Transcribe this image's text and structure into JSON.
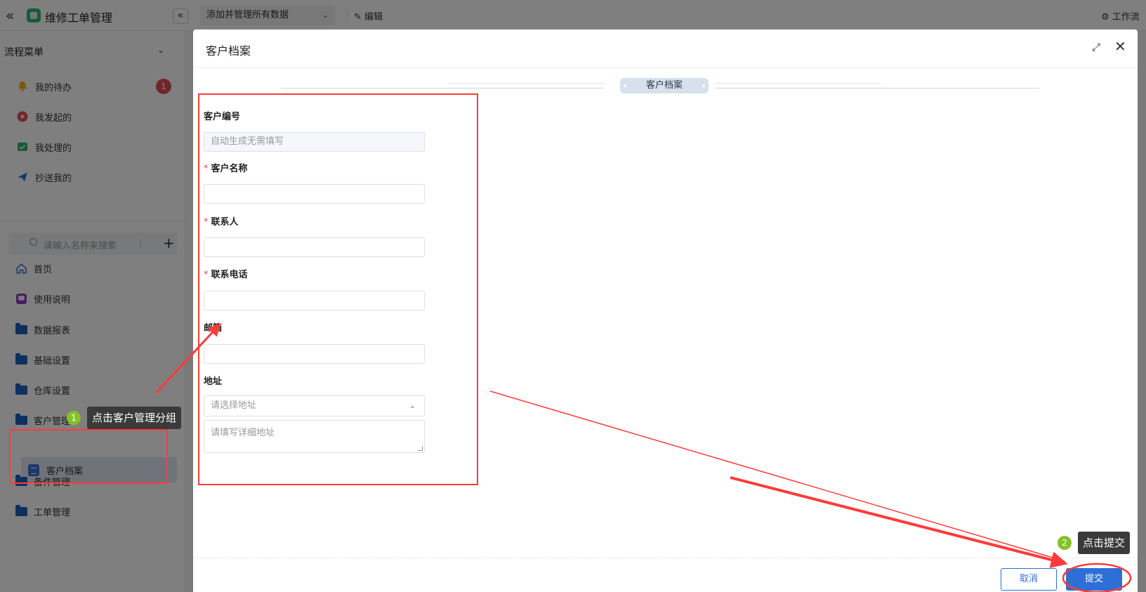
{
  "app": {
    "title": "维修工单管理",
    "view_select": "添加并管理所有数据",
    "edit_label": "编辑",
    "workflow_label": "工作流"
  },
  "sidebar": {
    "section_title": "流程菜单",
    "flow_items": [
      {
        "label": "我的待办",
        "icon": "bell-icon",
        "badge": "1"
      },
      {
        "label": "我发起的",
        "icon": "play-circle-icon"
      },
      {
        "label": "我处理的",
        "icon": "check-box-icon"
      },
      {
        "label": "抄送我的",
        "icon": "send-icon"
      }
    ],
    "search_placeholder": "请输入名称来搜索",
    "nav_items": [
      {
        "label": "首页",
        "icon": "home-icon"
      },
      {
        "label": "使用说明",
        "icon": "guide-icon"
      },
      {
        "label": "数据报表",
        "icon": "folder-icon"
      },
      {
        "label": "基础设置",
        "icon": "folder-icon"
      },
      {
        "label": "仓库设置",
        "icon": "folder-icon"
      },
      {
        "label": "客户管理",
        "icon": "folder-open-icon"
      },
      {
        "label": "备件管理",
        "icon": "folder-icon"
      },
      {
        "label": "工单管理",
        "icon": "folder-icon"
      }
    ],
    "active_sub_item": "客户档案"
  },
  "dialog": {
    "title": "客户档案",
    "section_tag": "客户档案",
    "fields": {
      "customer_no": {
        "label": "客户编号",
        "placeholder": "自动生成无需填写",
        "required": false
      },
      "customer_name": {
        "label": "客户名称",
        "value": "",
        "required": true
      },
      "contact": {
        "label": "联系人",
        "value": "",
        "required": true
      },
      "phone": {
        "label": "联系电话",
        "value": "",
        "required": true
      },
      "email": {
        "label": "邮箱",
        "value": "",
        "required": false
      },
      "address": {
        "label": "地址",
        "select_placeholder": "请选择地址",
        "detail_placeholder": "请填写详细地址",
        "required": false
      }
    },
    "cancel_label": "取消",
    "submit_label": "提交"
  },
  "annotations": {
    "tip1": {
      "step": "1",
      "text": "点击客户管理分组"
    },
    "tip2": {
      "step": "2",
      "text": "点击提交"
    },
    "highlight_color": "#ff3b3b"
  },
  "colors": {
    "primary": "#2d6fd6",
    "required": "#e34d59",
    "badge": "#e34d59",
    "step": "#84c225"
  }
}
